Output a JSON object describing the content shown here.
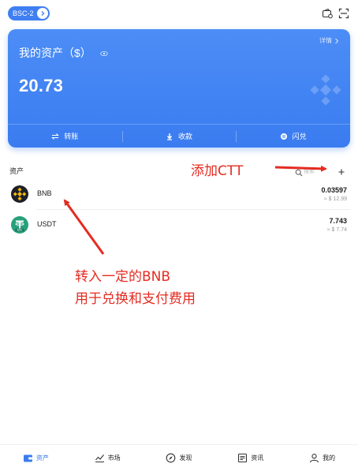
{
  "header": {
    "network_label": "BSC-2"
  },
  "card": {
    "title": "我的资产（$）",
    "details_label": "详情",
    "total_amount": "20.73",
    "actions": [
      {
        "label": "转账",
        "icon": "transfer-icon"
      },
      {
        "label": "收款",
        "icon": "receive-icon"
      },
      {
        "label": "闪兑",
        "icon": "swap-icon"
      }
    ]
  },
  "assets": {
    "section_title": "资产",
    "search_label": "搜索",
    "items": [
      {
        "name": "BNB",
        "balance": "0.03597",
        "fiat": "≈ $ 12.99",
        "icon": "bnb-icon"
      },
      {
        "name": "USDT",
        "balance": "7.743",
        "fiat": "≈ $ 7.74",
        "icon": "usdt-icon"
      }
    ]
  },
  "annotations": {
    "add_ctt": "添加CTT",
    "line1": "转入一定的BNB",
    "line2": "用于兑换和支付费用"
  },
  "bottom_nav": {
    "items": [
      {
        "label": "资产",
        "active": true
      },
      {
        "label": "市场",
        "active": false
      },
      {
        "label": "发现",
        "active": false
      },
      {
        "label": "资讯",
        "active": false
      },
      {
        "label": "我的",
        "active": false
      }
    ]
  },
  "colors": {
    "primary": "#3a7cf0",
    "annotation": "#e52b21",
    "bnb": "#f0b90b",
    "usdt": "#26a17b"
  }
}
